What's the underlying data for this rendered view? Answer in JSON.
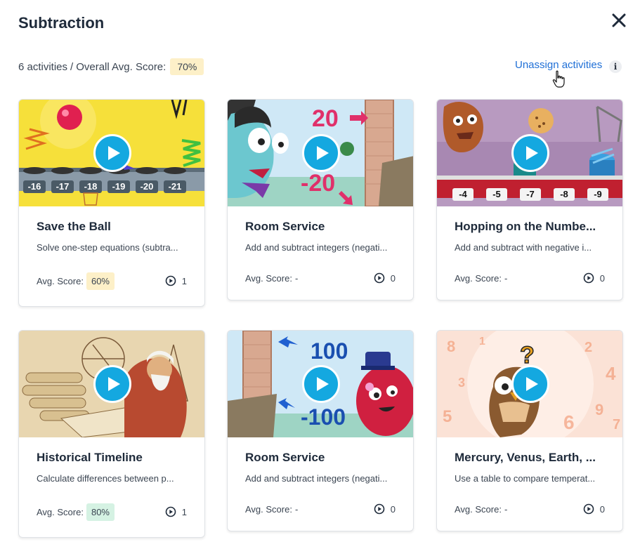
{
  "header": {
    "title": "Subtraction",
    "summary_count": "6 activities",
    "summary_separator": "/",
    "summary_label": "Overall Avg. Score:",
    "overall_score": "70%",
    "unassign_label": "Unassign activities",
    "info_glyph": "i"
  },
  "cards": [
    {
      "title": "Save the Ball",
      "description": "Solve one-step equations (subtra...",
      "score_label": "Avg. Score:",
      "score": "60%",
      "plays": "1",
      "score_color": "#fdf0c8"
    },
    {
      "title": "Room Service",
      "description": "Add and subtract integers (negati...",
      "score_label": "Avg. Score:",
      "score": "-",
      "plays": "0"
    },
    {
      "title": "Hopping on the Numbe...",
      "description": "Add and subtract with negative i...",
      "score_label": "Avg. Score:",
      "score": "-",
      "plays": "0"
    },
    {
      "title": "Historical Timeline",
      "description": "Calculate differences between p...",
      "score_label": "Avg. Score:",
      "score": "80%",
      "plays": "1",
      "score_color": "#d5f2e3"
    },
    {
      "title": "Room Service",
      "description": "Add and subtract integers (negati...",
      "score_label": "Avg. Score:",
      "score": "-",
      "plays": "0"
    },
    {
      "title": "Mercury, Venus, Earth, ...",
      "description": "Use a table to compare temperat...",
      "score_label": "Avg. Score:",
      "score": "-",
      "plays": "0"
    }
  ],
  "thumbnails": {
    "card0": {
      "numbers": [
        "-16",
        "-17",
        "-18",
        "-19",
        "-20",
        "-21"
      ]
    },
    "card1": {
      "top": "20",
      "bottom": "-20"
    },
    "card2": {
      "numbers": [
        "-4",
        "-5",
        "-7",
        "-8",
        "-9"
      ]
    },
    "card4": {
      "top": "100",
      "bottom": "-100"
    },
    "card5": {
      "glyph": "?"
    }
  },
  "colors": {
    "accent": "#14a8e0",
    "link": "#1f6fd6",
    "score_yellow": "#fdf0c8",
    "score_green": "#d5f2e3"
  },
  "icons": [
    "close-icon",
    "info-icon",
    "play-icon",
    "play-count-icon",
    "hand-pointer-icon"
  ]
}
